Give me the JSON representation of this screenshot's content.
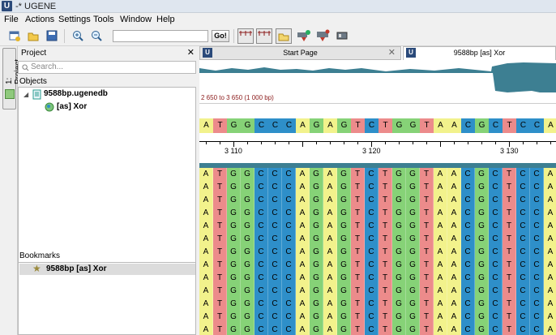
{
  "window": {
    "title": "-* UGENE",
    "logo": "U"
  },
  "menu": [
    "File",
    "Actions",
    "Settings",
    "Tools",
    "Window",
    "Help"
  ],
  "toolbar": {
    "go_label": "Go!",
    "toggle1": "5'\n3'",
    "toggle2": "5'\nC 3'\n5'"
  },
  "project": {
    "panel_title": "Project",
    "tab_label": "1: Project",
    "search_placeholder": "Search...",
    "objects_label": "Objects",
    "tree": [
      {
        "label": "9588bp.ugenedb"
      },
      {
        "label": "[as] Xor"
      }
    ],
    "bookmarks_label": "Bookmarks",
    "bookmarks": [
      {
        "label": "9588bp [as] Xor"
      }
    ]
  },
  "tabs": [
    {
      "label": "Start Page"
    },
    {
      "label": "9588bp [as] Xor"
    }
  ],
  "view": {
    "range": "2 650 to 3 650 (1 000 bp)",
    "ruler": [
      "3 110",
      "3 120",
      "3 130"
    ],
    "sequence": "ATGGCCCAGAGTCTGGTAACGCTCCA"
  },
  "alignment": {
    "rows": [
      "ATGGCCCAGAGTCTGGTAACGCTCCA",
      "ATGGCCCAGAGTCTGGTAACGCTCCA",
      "ATGGCCCAGAGTCTGGTAACGCTCCA",
      "ATGGCCCAGAGTCTGGTAACGCTCCA",
      "ATGGCCCAGAGTCTGGTAACGCTCCA",
      "ATGGCCCAGAGTCTGGTAACGCTCCA",
      "ATGGCCCAGAGTCTGGTAACGCTCCA",
      "ATGGCCCAGAGTCTGGTAACGCTCCA",
      "ATGGCCCAGAGTCTGGTAACGCTCCA",
      "ATGGCCCAGAGTCTGGTAACGCTCCA",
      "ATGGCCCAGAGTCTGGTAACGCTCCA",
      "ATGGCCCAGAGTCTGGTAACGCTCCA",
      "ATGGCCCAGAGTCTGGTAACGCTCCA"
    ]
  },
  "colors": {
    "A": "#f2f28c",
    "T": "#ec8b8b",
    "G": "#86d277",
    "C": "#2e8fc9",
    "overview": "#3d7f92"
  }
}
